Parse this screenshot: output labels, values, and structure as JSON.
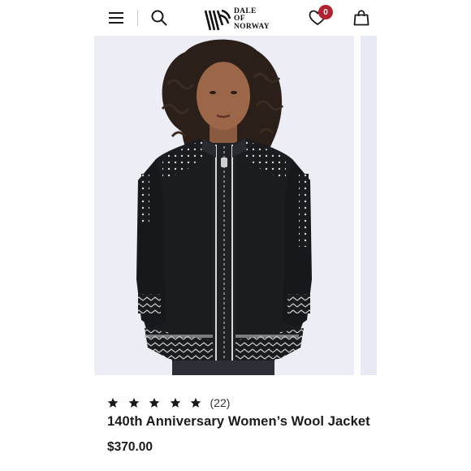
{
  "header": {
    "menu_icon": "hamburger-menu-icon",
    "search_icon": "search-icon",
    "logo": {
      "line1": "DALE",
      "line2": "OF",
      "line3": "NORWAY"
    },
    "wishlist_icon": "heart-icon",
    "wishlist_count": "0",
    "cart_icon": "shopping-bag-icon",
    "badge_color": "#b3232f"
  },
  "product": {
    "image_alt_subject": "woman wearing black wool zip jacket with white Nordic pattern",
    "rating_stars": 5,
    "review_count": "(22)",
    "title": "140th Anniversary Women’s Wool Jacket",
    "price": "$370.00"
  }
}
